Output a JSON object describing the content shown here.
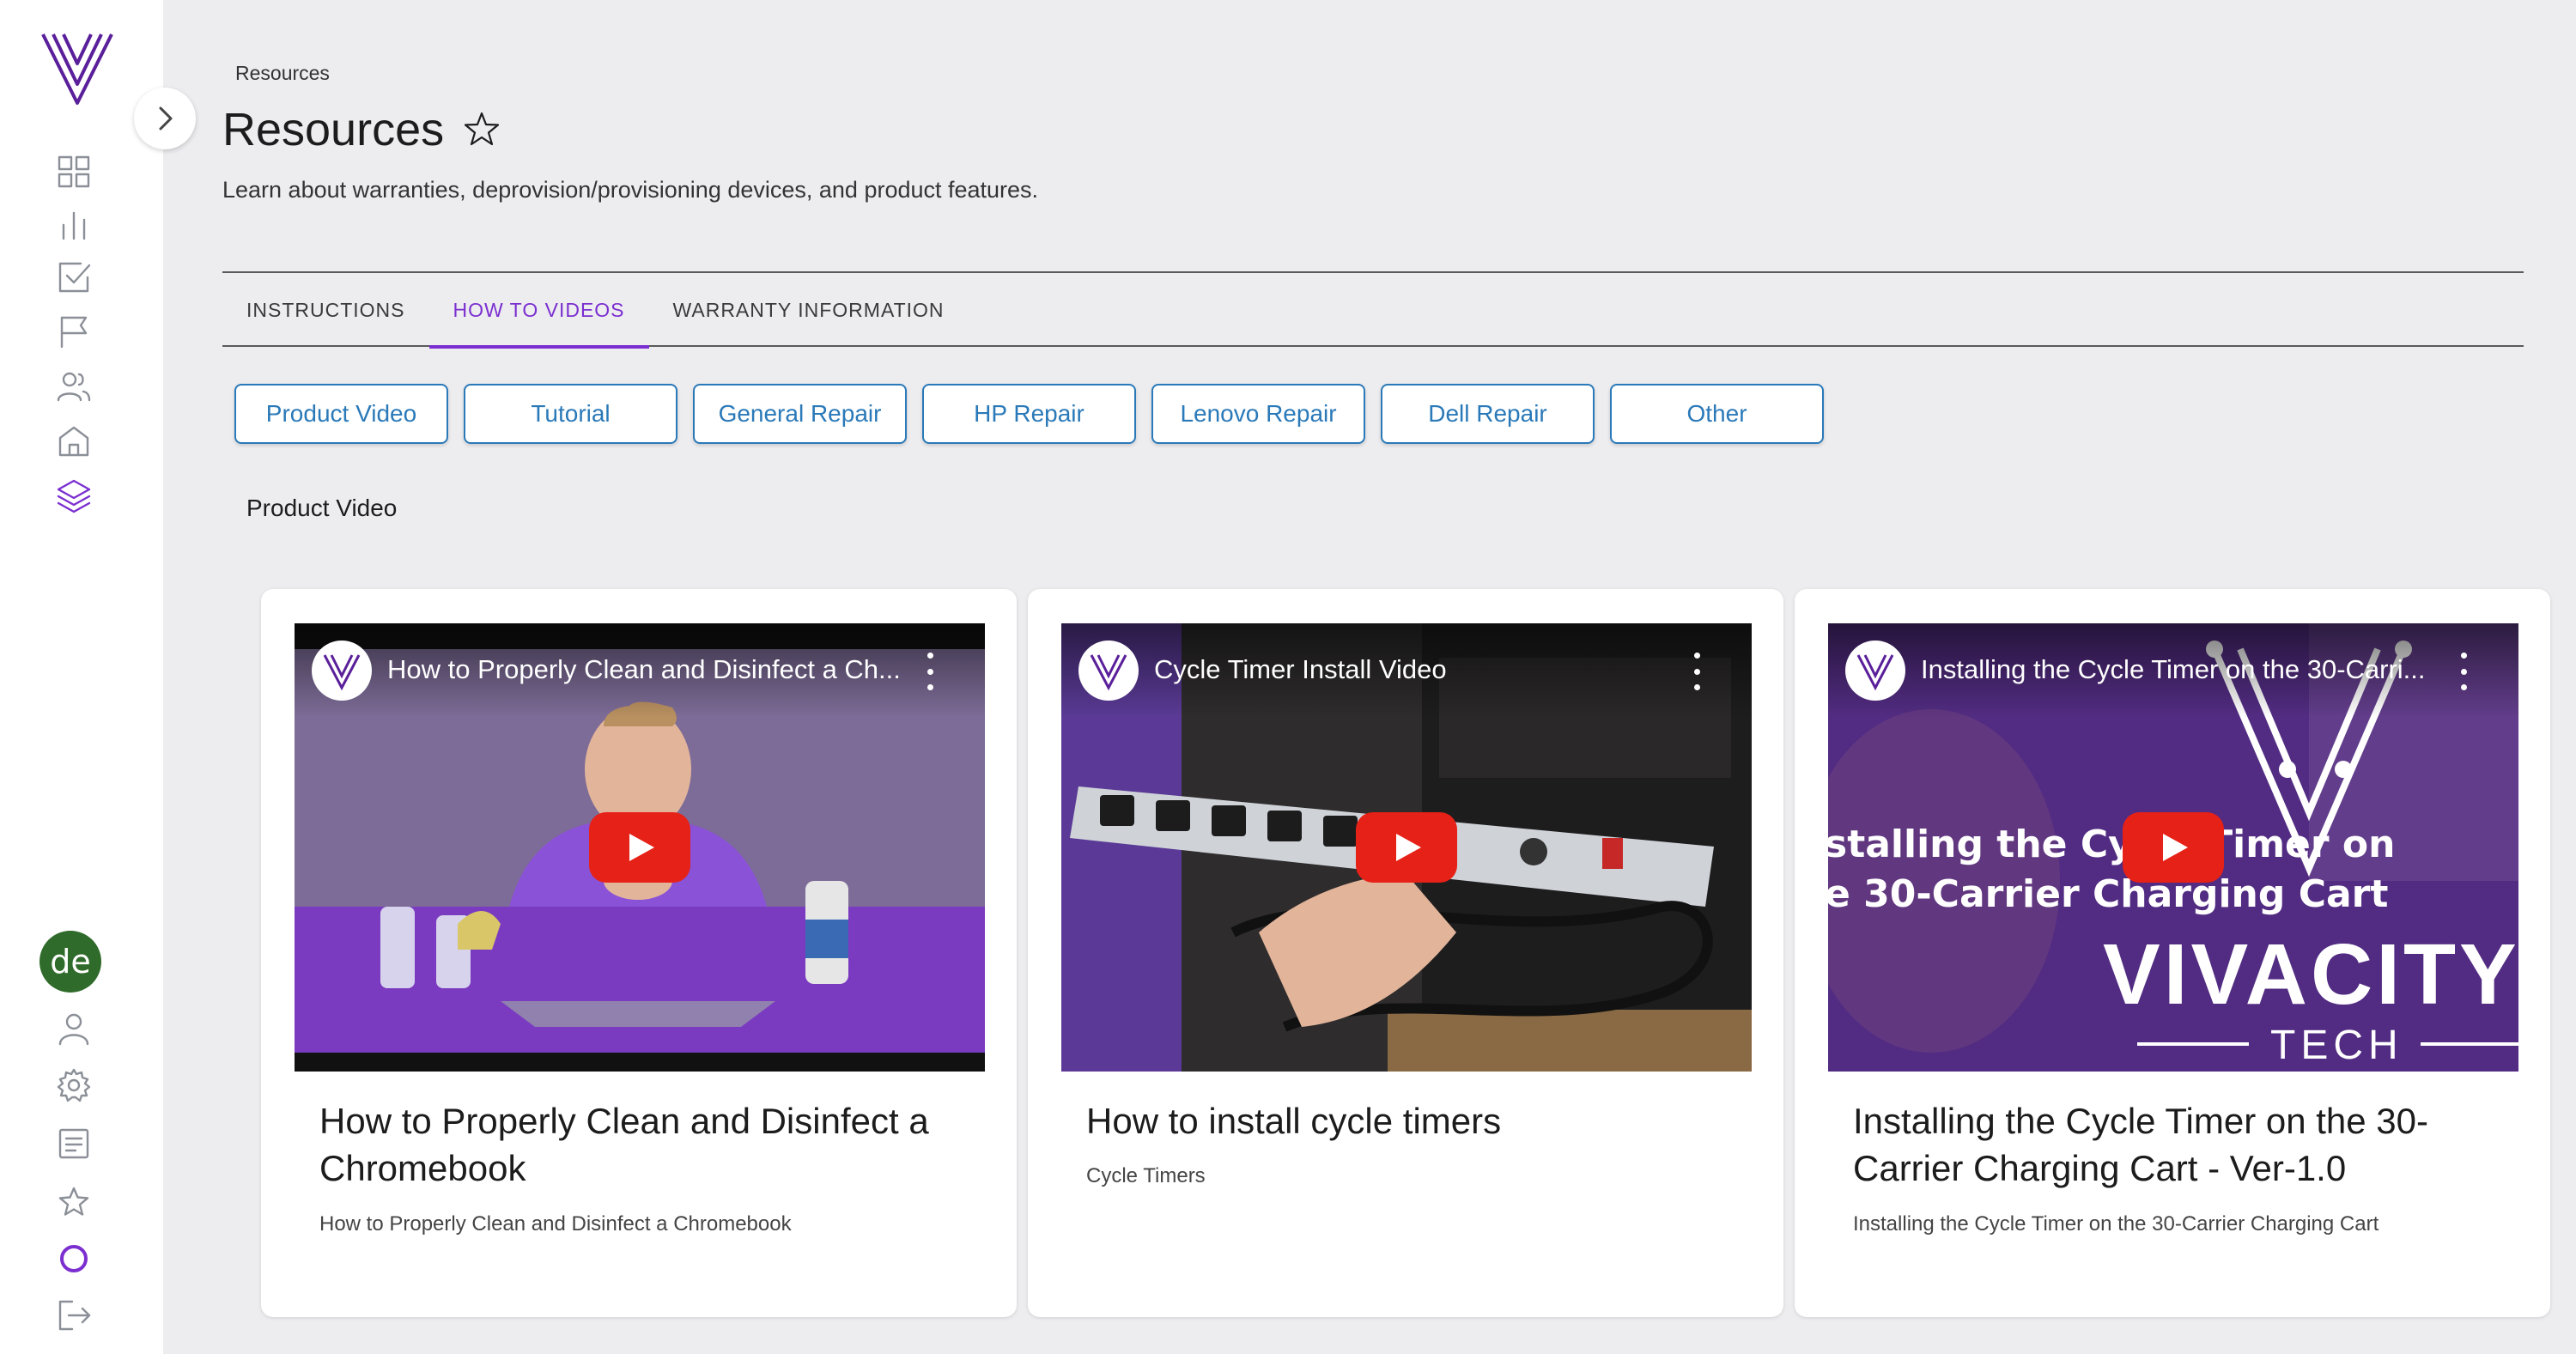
{
  "sidebar": {
    "nav_items": [
      {
        "name": "dashboard-icon"
      },
      {
        "name": "reports-icon"
      },
      {
        "name": "tasks-icon"
      },
      {
        "name": "flag-icon"
      },
      {
        "name": "users-icon"
      },
      {
        "name": "home-icon"
      },
      {
        "name": "layers-icon",
        "active": true
      }
    ],
    "avatar_initials": "de",
    "bottom_items": [
      "profile-icon",
      "settings-icon",
      "document-icon",
      "favorites-icon",
      "circle-icon",
      "logout-icon"
    ]
  },
  "breadcrumb": "Resources",
  "page": {
    "title": "Resources",
    "subtitle": "Learn about warranties, deprovision/provisioning devices, and product features."
  },
  "tabs": [
    {
      "label": "INSTRUCTIONS",
      "active": false
    },
    {
      "label": "HOW TO VIDEOS",
      "active": true
    },
    {
      "label": "WARRANTY INFORMATION",
      "active": false
    }
  ],
  "filters": [
    "Product Video",
    "Tutorial",
    "General Repair",
    "HP Repair",
    "Lenovo Repair",
    "Dell Repair",
    "Other"
  ],
  "section_title": "Product Video",
  "videos": [
    {
      "video_title": "How to Properly Clean and Disinfect a Ch...",
      "title": "How to Properly Clean and Disinfect a Chromebook",
      "description": "How to Properly Clean and Disinfect a Chromebook"
    },
    {
      "video_title": "Cycle Timer Install Video",
      "title": "How to install cycle timers",
      "description": "Cycle Timers"
    },
    {
      "video_title": "Installing the Cycle Timer on the 30-Carri...",
      "title": "Installing the Cycle Timer on the 30-Carrier Charging Cart - Ver-1.0",
      "description": "Installing the Cycle Timer on the 30-Carrier Charging Cart",
      "overlay_line1": "stalling the Cycle Timer on",
      "overlay_line2": "e 30-Carrier Charging Cart",
      "brand_word": "VIVACITY",
      "brand_sub": "TECH"
    }
  ],
  "colors": {
    "accent": "#7b2fd0",
    "filter_blue": "#2a79b8",
    "youtube_red": "#e62117",
    "avatar_green": "#2f6b2a"
  }
}
